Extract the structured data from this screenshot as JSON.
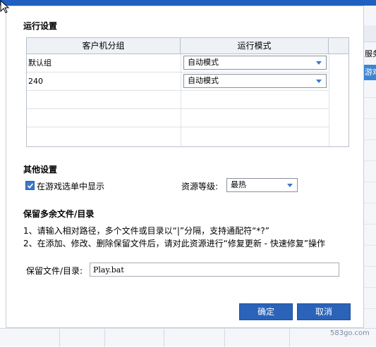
{
  "background": {
    "right_header_partial": "服务",
    "right_row_partial": "游戏"
  },
  "run_settings": {
    "title": "运行设置",
    "columns": [
      "客户机分组",
      "运行模式"
    ],
    "rows": [
      {
        "group": "默认组",
        "mode": "自动模式"
      },
      {
        "group": "240",
        "mode": "自动模式"
      }
    ]
  },
  "other_settings": {
    "title": "其他设置",
    "show_in_menu_label": "在游戏选单中显示",
    "show_in_menu_checked": true,
    "resource_level_label": "资源等级:",
    "resource_level_value": "最热"
  },
  "keep_files": {
    "title": "保留多余文件/目录",
    "note1": "1、请输入相对路径，多个文件或目录以“|”分隔，支持通配符“*?”",
    "note2": "2、在添加、修改、删除保留文件后，请对此资源进行“修复更新 - 快速修复”操作",
    "field_label": "保留文件/目录:",
    "field_value": "Play.bat"
  },
  "buttons": {
    "ok": "确定",
    "cancel": "取消"
  },
  "watermark": "583go.com",
  "colors": {
    "accent": "#2a63b8",
    "title_bar": "#1f5fbf"
  }
}
